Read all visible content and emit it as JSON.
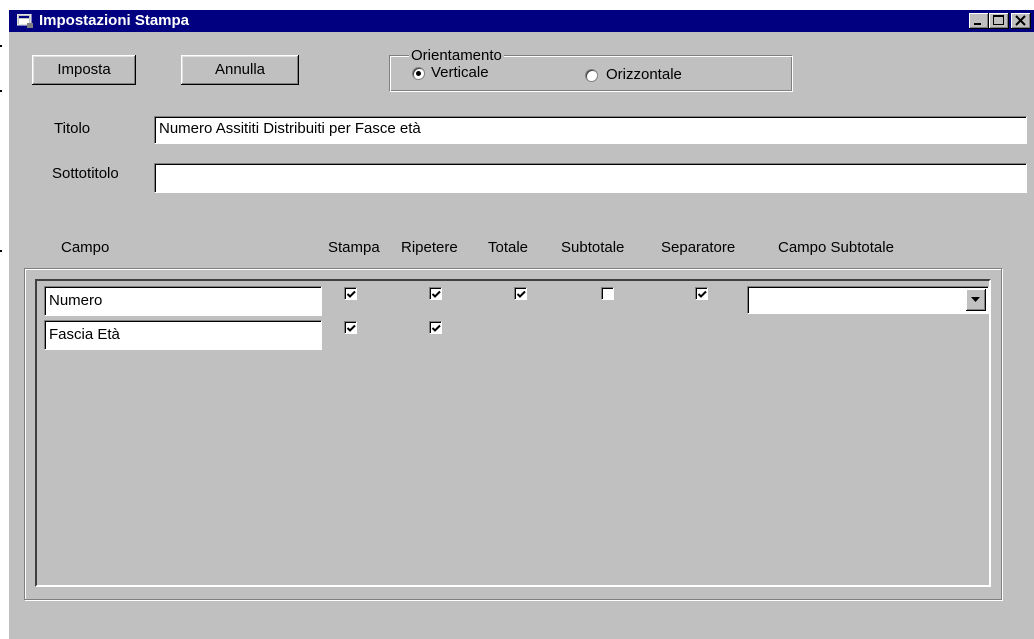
{
  "window": {
    "title": "Impostazioni Stampa",
    "controls": {
      "minimize": "_",
      "maximize": "□",
      "close": "×"
    }
  },
  "toolbar": {
    "imposta_label": "Imposta",
    "annulla_label": "Annulla"
  },
  "orientation": {
    "group_label": "Orientamento",
    "options": [
      {
        "label": "Verticale",
        "selected": true
      },
      {
        "label": "Orizzontale",
        "selected": false
      }
    ]
  },
  "form": {
    "title_label": "Titolo",
    "title_value": "Numero Assititi Distribuiti per Fasce età",
    "subtitle_label": "Sottotitolo",
    "subtitle_value": ""
  },
  "columns": [
    "Campo",
    "Stampa",
    "Ripetere",
    "Totale",
    "Subtotale",
    "Separatore",
    "Campo Subtotale"
  ],
  "rows": [
    {
      "campo": "Numero",
      "stampa": true,
      "ripetere": true,
      "totale": true,
      "subtotale": false,
      "separatore": true,
      "campo_subtotale": ""
    },
    {
      "campo": "Fascia Età",
      "stampa": true,
      "ripetere": true
    }
  ],
  "icons": {
    "app": "window-app-icon",
    "radio": "radio-button",
    "check": "checkmark-icon",
    "dropdown": "dropdown-arrow-icon"
  },
  "colors": {
    "face": "#c0c0c0",
    "titlebar": "#000080",
    "field": "#ffffff"
  }
}
